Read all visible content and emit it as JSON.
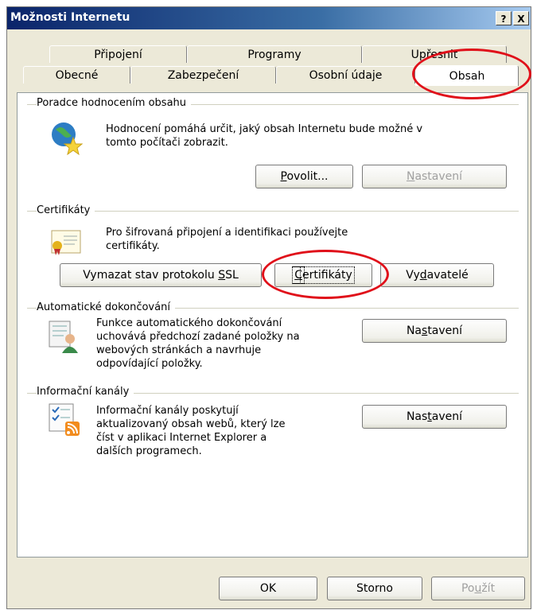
{
  "window": {
    "title": "Možnosti Internetu",
    "help_label": "?",
    "close_label": "X"
  },
  "tabs": {
    "row1": [
      "Připojení",
      "Programy",
      "Upřesnit"
    ],
    "row2": [
      "Obecné",
      "Zabezpečení",
      "Osobní údaje",
      "Obsah"
    ],
    "active": "Obsah"
  },
  "ratings": {
    "heading": "Poradce hodnocením obsahu",
    "desc_line1": "Hodnocení pomáhá určit, jaký obsah Internetu bude možné v",
    "desc_line2": "tomto počítači zobrazit.",
    "enable_label_u": "P",
    "enable_label_rest": "ovolit...",
    "settings_label_u": "N",
    "settings_label_rest": "astavení"
  },
  "certificates": {
    "heading": "Certifikáty",
    "desc_line1": "Pro šifrovaná připojení a identifikaci používejte",
    "desc_line2": "certifikáty.",
    "clear_ssl_pre": "Vymazat stav protokolu ",
    "clear_ssl_u": "S",
    "clear_ssl_post": "SL",
    "certs_u": "C",
    "certs_rest": "ertifikáty",
    "publishers_pre": "Vy",
    "publishers_u": "d",
    "publishers_post": "avatelé"
  },
  "autocomplete": {
    "heading": "Automatické dokončování",
    "desc": [
      "Funkce automatického dokončování",
      "uchovává předchozí zadané položky na",
      "webových stránkách a navrhuje",
      "odpovídající položky."
    ],
    "settings_pre": "Na",
    "settings_u": "s",
    "settings_post": "tavení"
  },
  "feeds": {
    "heading": "Informační kanály",
    "desc": [
      "Informační kanály poskytují",
      "aktualizovaný obsah webů, který lze",
      "číst v aplikaci Internet Explorer a",
      "dalších programech."
    ],
    "settings_pre": "Nas",
    "settings_u": "t",
    "settings_post": "avení"
  },
  "footer": {
    "ok": "OK",
    "cancel": "Storno",
    "apply_pre": "Po",
    "apply_u": "u",
    "apply_post": "žít"
  },
  "colors": {
    "highlight_oval": "#e0101a",
    "title_bar": "#0a246a"
  }
}
